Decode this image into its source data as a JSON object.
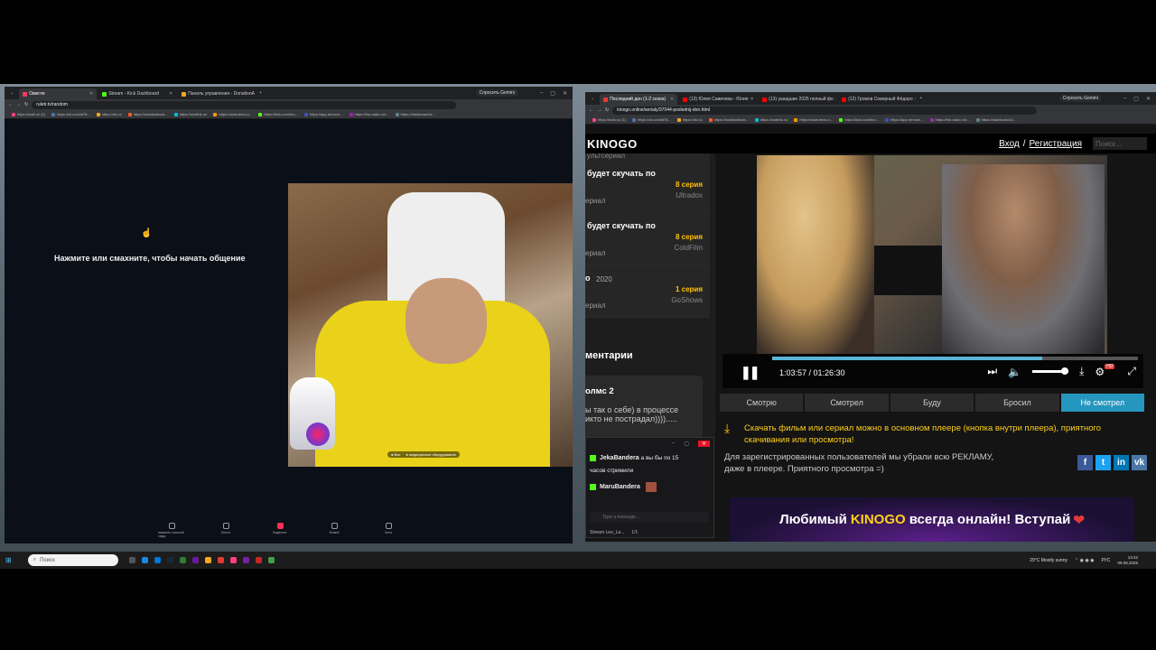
{
  "left_browser": {
    "tabs": [
      {
        "label": "Омегле",
        "color": "#ff3b5c",
        "active": true
      },
      {
        "label": "Stream - Kick Dashboard",
        "color": "#53fc18",
        "active": false
      },
      {
        "label": "Панель управления - DonationA",
        "color": "#f5a623",
        "active": false
      }
    ],
    "url": "ruletr.tv/random",
    "gemini": "Спросить Gemini",
    "bookmarks": [
      "https://mail.ru/ (1)",
      "https://vk.com/id78...",
      "https://ok.ru/",
      "https://wordlanbook...",
      "https://onelink.ru/",
      "https://www.temu.c...",
      "https://kick.com/bro...",
      "https://app.remove...",
      "https://the-radio.ru/r...",
      "https://dashboard.ki..."
    ]
  },
  "omegle": {
    "hand_icon": "☝",
    "prompt": "Нажмите или смахните, чтобы начать общение",
    "cam_label_left": "● Все",
    "cam_label_right": "● медицинское оборудование",
    "nav": [
      {
        "label": "нажмите ссылкой сюда",
        "active": false
      },
      {
        "label": "Ленты",
        "active": false
      },
      {
        "label": "Видеочат",
        "active": true
      },
      {
        "label": "Живой",
        "active": false
      },
      {
        "label": "Чаты",
        "active": false
      }
    ]
  },
  "right_browser": {
    "tabs": [
      {
        "label": "Последний дон (1-2 сезон)",
        "color": "#e53935",
        "active": true
      },
      {
        "label": "(13) Юлия Савичева - Юлия",
        "color": "#ff0000",
        "active": false
      },
      {
        "label": "(13) ушедшие 2025 полный фо",
        "color": "#ff0000",
        "active": false
      },
      {
        "label": "(12) Громов Северный Фёдоро",
        "color": "#ff0000",
        "active": false
      }
    ],
    "url": "kinogo.online/serialy/37044-poslednij-don.html",
    "gemini": "Спросить Gemini"
  },
  "kinogo": {
    "logo": "KINOGO",
    "login": "Вход",
    "sep": "/",
    "register": "Регистрация",
    "search_placeholder": "Поиск...",
    "sidebar_top": "ультсериал",
    "sidebar": [
      {
        "title": "будет скучать по",
        "sub": "ериал",
        "episode": "8 серия",
        "source": "Ultradox",
        "year": ""
      },
      {
        "title": "будет скучать по",
        "sub": "ериал",
        "episode": "8 серия",
        "source": "ColdFilm",
        "year": ""
      },
      {
        "title": "о",
        "sub": "ериал",
        "episode": "1 серия",
        "source": "GoShows",
        "year": "2020"
      }
    ],
    "comments_heading": "ментарии",
    "comment_author": "олмс 2",
    "comment_text1": "ы так о себе) в процессе",
    "comment_text2": "икто не пострадал)))).....",
    "player": {
      "time": "1:03:57 / 01:26:30",
      "progress": 0.739,
      "pause_icon": "❚❚",
      "hd": "HD"
    },
    "status_buttons": [
      {
        "label": "Смотрю",
        "active": false
      },
      {
        "label": "Смотрел",
        "active": false
      },
      {
        "label": "Буду",
        "active": false
      },
      {
        "label": "Бросил",
        "active": false
      },
      {
        "label": "Не смотрел",
        "active": true
      }
    ],
    "download_note": "Скачать фильм или сериал можно в основном плеере (кнопка внутри плеера), приятного скачивания или просмотра!",
    "reg_note1": "Для зарегистрированных пользователей мы убрали всю РЕКЛАМУ,",
    "reg_note2": "даже в плеере. Приятного просмотра =)",
    "social": [
      {
        "label": "f",
        "color": "#3b5998"
      },
      {
        "label": "t",
        "color": "#1da1f2"
      },
      {
        "label": "in",
        "color": "#0077b5"
      },
      {
        "label": "vk",
        "color": "#4a76a8"
      }
    ],
    "banner_a": "Любимый",
    "banner_b": "KINOGO",
    "banner_c": "всегда онлайн! Вступай",
    "banner_heart": "❤"
  },
  "chat_popup": {
    "user1": "JekaBandera",
    "msg1": "а вы бы по 15",
    "msg1b": "часов стримили",
    "user2": "MaruBandera",
    "input_placeholder": "Type a message...",
    "stream_label": "Stream Leo_La...",
    "viewers": "1/1"
  },
  "taskbar": {
    "search": "Поиск",
    "weather": "29°C Mostly sunny",
    "lang": "РУС",
    "time": "13:42",
    "date": "09.08.2025"
  }
}
